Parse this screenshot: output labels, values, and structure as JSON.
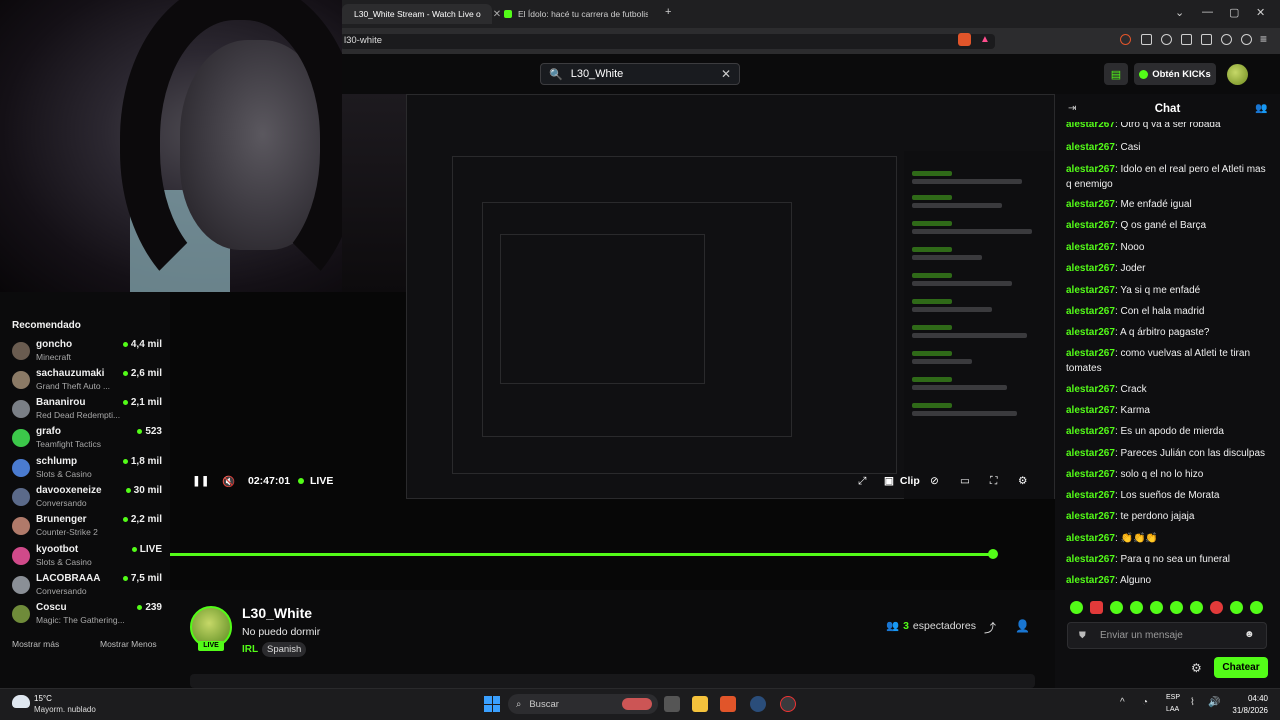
{
  "browser": {
    "tabs": [
      {
        "label": "L30_White Stream - Watch Live o"
      },
      {
        "label": "El Ídolo: hacé tu carrera de futbolista"
      }
    ],
    "url": "l30-white"
  },
  "header": {
    "search_value": "L30_White",
    "kicks_button": "Obtén KICKs"
  },
  "sidebar": {
    "title": "Recomendado",
    "channels": [
      {
        "name": "goncho",
        "game": "Minecraft",
        "viewers": "4,4 mil",
        "color": "#6a5c50"
      },
      {
        "name": "sachauzumaki",
        "game": "Grand Theft Auto ...",
        "viewers": "2,6 mil",
        "color": "#8b7a66"
      },
      {
        "name": "Bananirou",
        "game": "Red Dead Redempti...",
        "viewers": "2,1 mil",
        "color": "#7a7f86"
      },
      {
        "name": "grafo",
        "game": "Teamfight Tactics",
        "viewers": "523",
        "color": "#3cc84a"
      },
      {
        "name": "schlump",
        "game": "Slots & Casino",
        "viewers": "1,8 mil",
        "color": "#4a7bd0"
      },
      {
        "name": "davooxeneize",
        "game": "Conversando",
        "viewers": "30 mil",
        "color": "#5b6a8a"
      },
      {
        "name": "Brunenger",
        "game": "Counter-Strike 2",
        "viewers": "2,2 mil",
        "color": "#b07a6a"
      },
      {
        "name": "kyootbot",
        "game": "Slots & Casino",
        "viewers": "LIVE",
        "color": "#d04a8a"
      },
      {
        "name": "LACOBRAAA",
        "game": "Conversando",
        "viewers": "7,5 mil",
        "color": "#8a8f96"
      },
      {
        "name": "Coscu",
        "game": "Magic: The Gathering...",
        "viewers": "239",
        "color": "#6f8b3a"
      }
    ],
    "show_more": "Mostrar más",
    "show_less": "Mostrar Menos"
  },
  "player": {
    "time": "02:47:01",
    "live_label": "LIVE",
    "clip_label": "Clip",
    "progress": 0.93
  },
  "stream": {
    "streamer": "L30_White",
    "title": "No puedo dormir",
    "category": "IRL",
    "tag": "Spanish",
    "live_badge": "LIVE",
    "viewer_count": "3",
    "viewer_label": "espectadores"
  },
  "chat": {
    "title": "Chat",
    "messages": [
      {
        "user": "alestar267",
        "text": "Otro q va a ser robada"
      },
      {
        "user": "alestar267",
        "text": "Casi"
      },
      {
        "user": "alestar267",
        "text": "Idolo en el real pero el Atleti mas q enemigo"
      },
      {
        "user": "alestar267",
        "text": "Me enfadé igual"
      },
      {
        "user": "alestar267",
        "text": "Q os gané el Barça"
      },
      {
        "user": "alestar267",
        "text": "Nooo"
      },
      {
        "user": "alestar267",
        "text": "Joder"
      },
      {
        "user": "alestar267",
        "text": "Ya si q me enfadé"
      },
      {
        "user": "alestar267",
        "text": "Con el hala madrid"
      },
      {
        "user": "alestar267",
        "text": "A q árbitro pagaste?"
      },
      {
        "user": "alestar267",
        "text": "como vuelvas al Atleti te tiran tomates"
      },
      {
        "user": "alestar267",
        "text": "Crack"
      },
      {
        "user": "alestar267",
        "text": "Karma"
      },
      {
        "user": "alestar267",
        "text": "Es un apodo de mierda"
      },
      {
        "user": "alestar267",
        "text": "Pareces Julián con las disculpas"
      },
      {
        "user": "alestar267",
        "text": "solo q el no lo hizo"
      },
      {
        "user": "alestar267",
        "text": "Los sueños de Morata"
      },
      {
        "user": "alestar267",
        "text": "te perdono jajaja"
      },
      {
        "user": "alestar267",
        "text": "👏👏👏"
      },
      {
        "user": "alestar267",
        "text": "Para q no sea un funeral"
      },
      {
        "user": "alestar267",
        "text": "Alguno"
      }
    ],
    "input_placeholder": "Enviar un mensaje",
    "send_label": "Chatear"
  },
  "taskbar": {
    "weather_temp": "15°C",
    "weather_desc": "Mayorm. nublado",
    "search_label": "Buscar",
    "lang_1": "ESP",
    "lang_2": "LAA",
    "time": "04:40",
    "date": "31/8/2026"
  },
  "colors": {
    "accent": "#53fc18",
    "background": "#0b0b0c",
    "panel": "#0e0e10"
  }
}
